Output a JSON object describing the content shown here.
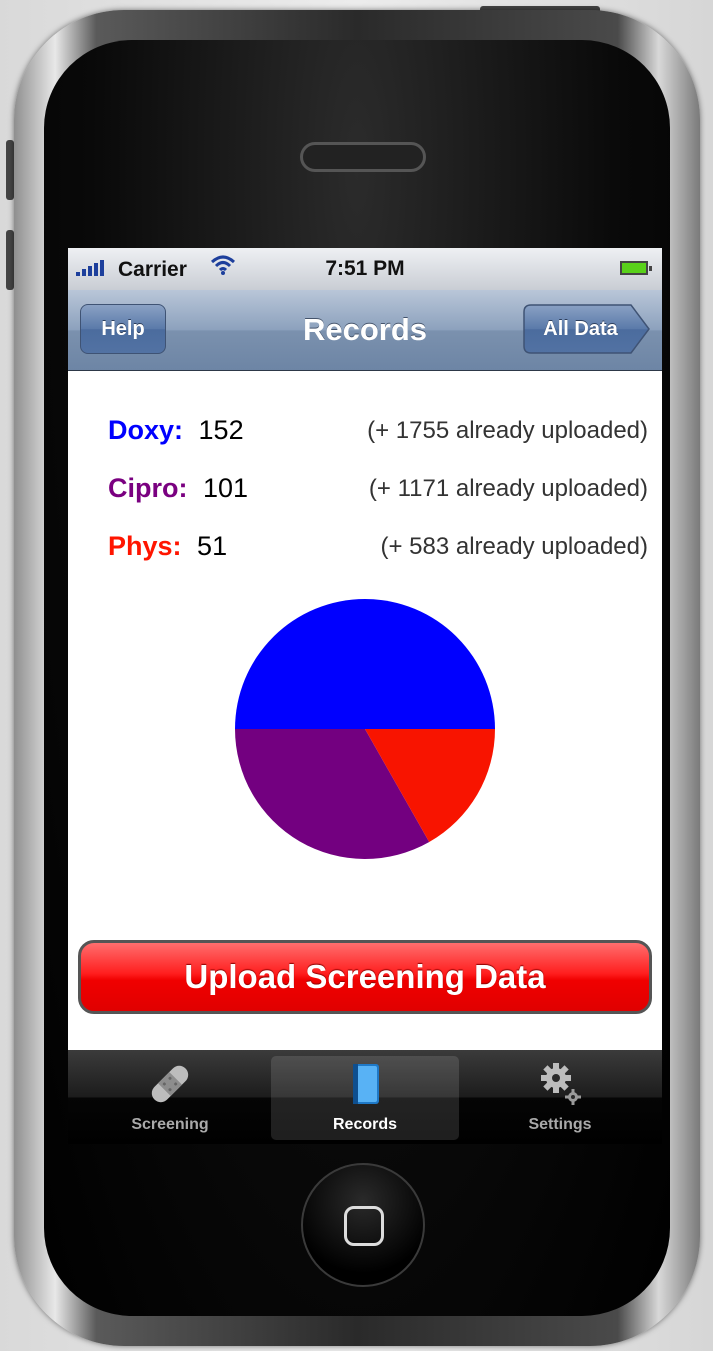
{
  "status": {
    "carrier": "Carrier",
    "time": "7:51 PM"
  },
  "nav": {
    "title": "Records",
    "left_button": "Help",
    "right_button": "All Data"
  },
  "records": [
    {
      "label": "Doxy:",
      "count": "152",
      "uploaded": "(+ 1755 already uploaded)",
      "color": "#0000ff"
    },
    {
      "label": "Cipro:",
      "count": "101",
      "uploaded": "(+ 1171 already uploaded)",
      "color": "#7a0080"
    },
    {
      "label": "Phys:",
      "count": "51",
      "uploaded": "(+ 583 already uploaded)",
      "color": "#ff1500"
    }
  ],
  "upload_button": "Upload Screening Data",
  "tabs": [
    {
      "label": "Screening",
      "icon": "bandage-icon",
      "active": false
    },
    {
      "label": "Records",
      "icon": "book-icon",
      "active": true
    },
    {
      "label": "Settings",
      "icon": "gears-icon",
      "active": false
    }
  ],
  "chart_data": {
    "type": "pie",
    "categories": [
      "Doxy",
      "Cipro",
      "Phys"
    ],
    "values": [
      152,
      101,
      51
    ],
    "colors": [
      "#0000ff",
      "#730080",
      "#f81400"
    ]
  }
}
